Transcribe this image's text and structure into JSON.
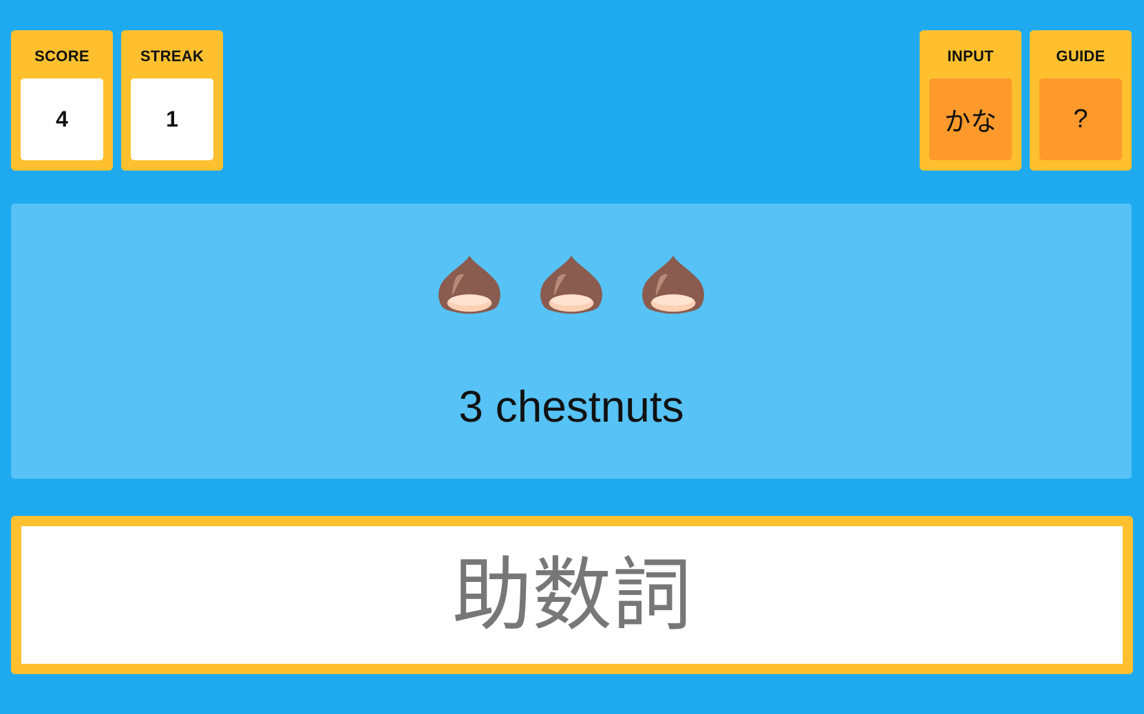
{
  "score": {
    "label": "SCORE",
    "value": "4"
  },
  "streak": {
    "label": "STREAK",
    "value": "1"
  },
  "input_mode": {
    "label": "INPUT",
    "value": "かな"
  },
  "guide": {
    "label": "GUIDE",
    "value": "?"
  },
  "prompt": {
    "emoji": [
      "chestnut-icon",
      "chestnut-icon",
      "chestnut-icon"
    ],
    "text": "3 chestnuts"
  },
  "answer": {
    "value": "",
    "placeholder": "助数詞"
  },
  "colors": {
    "background": "#1faaf0",
    "panel": "#56c2f5",
    "card": "#fec02e",
    "button": "#fe9a2b"
  }
}
